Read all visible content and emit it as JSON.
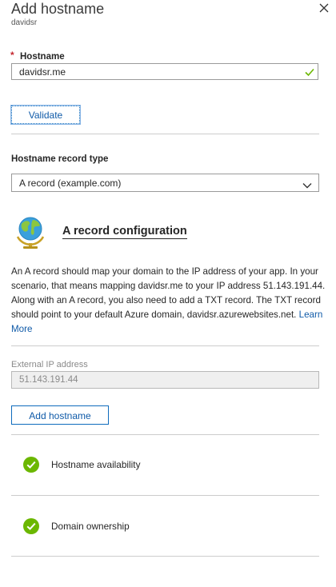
{
  "blade": {
    "title": "Add hostname",
    "subtitle": "davidsr"
  },
  "hostname": {
    "required_marker": "*",
    "label": "Hostname",
    "value": "davidsr.me"
  },
  "validate_label": "Validate",
  "record_type": {
    "label": "Hostname record type",
    "selected": "A record (example.com)"
  },
  "config": {
    "title": "A record configuration",
    "description": "An A record should map your domain to the IP address of your app. In your scenario, that means mapping davidsr.me to your IP address 51.143.191.44. Along with an A record, you also need to add a TXT record. The TXT record should point to your default Azure domain, davidsr.azurewebsites.net.",
    "learn_more": "Learn More"
  },
  "external_ip": {
    "label": "External IP address",
    "value": "51.143.191.44"
  },
  "add_hostname_label": "Add hostname",
  "checks": [
    {
      "label": "Hostname availability",
      "status": "success"
    },
    {
      "label": "Domain ownership",
      "status": "success"
    }
  ],
  "colors": {
    "accent": "#0f6cbd",
    "success": "#6bb700",
    "required": "#c4262e"
  }
}
